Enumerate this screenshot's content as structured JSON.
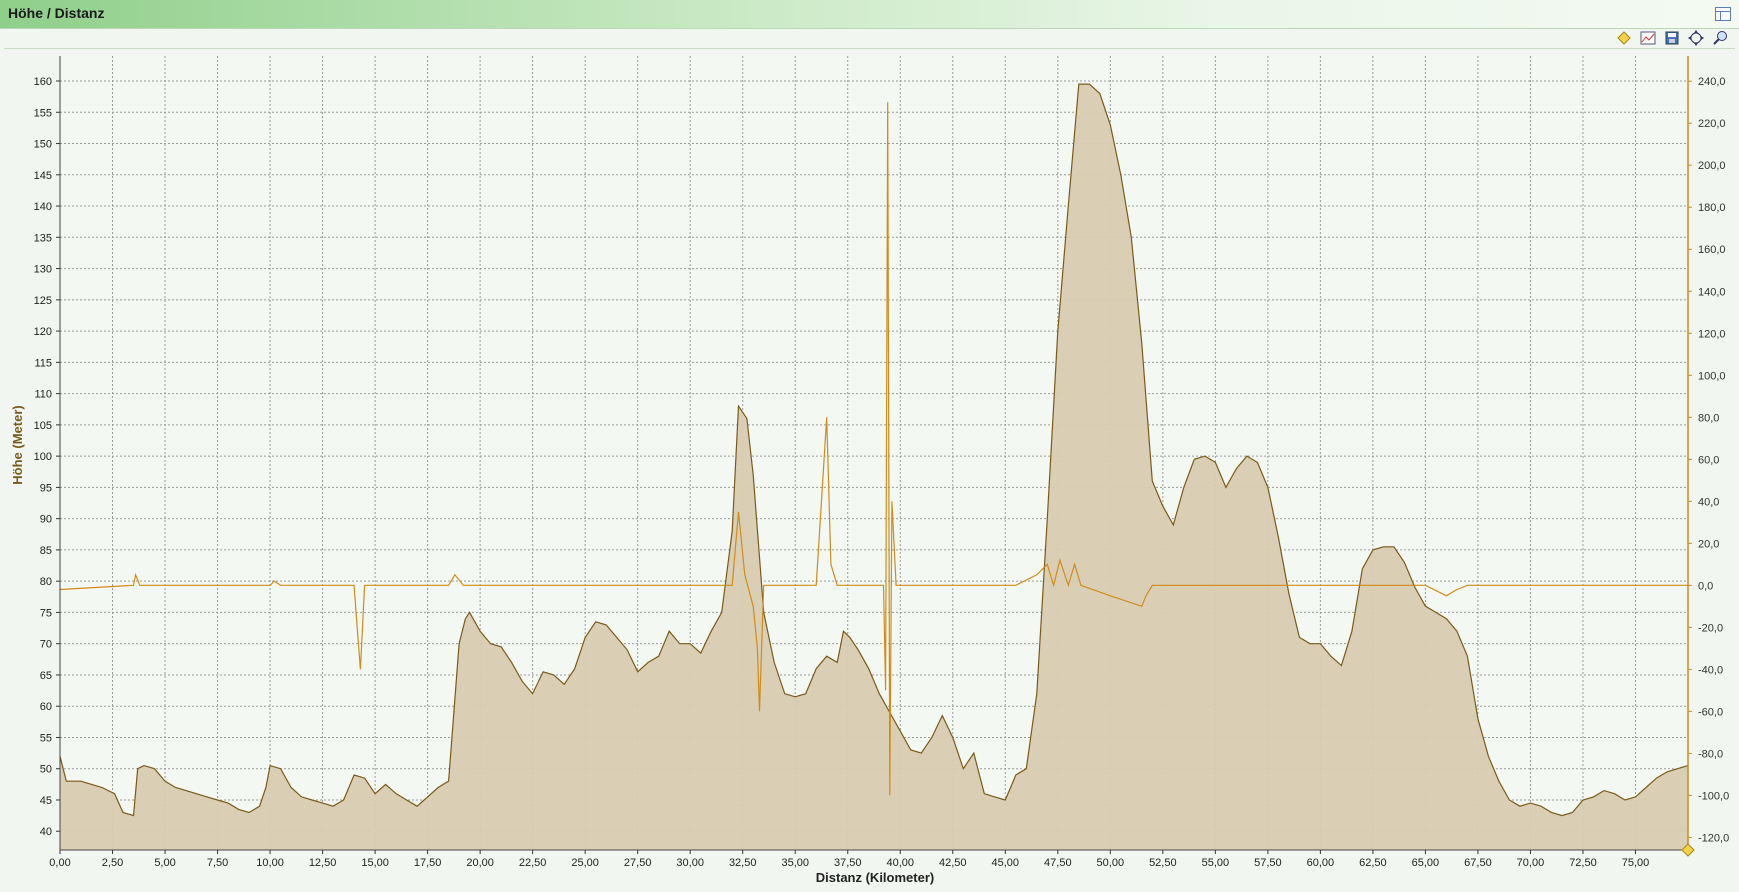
{
  "window": {
    "title": "Höhe / Distanz"
  },
  "toolbar": {
    "icons": [
      "diamond-marker-icon",
      "chart-view-icon",
      "save-icon",
      "center-icon",
      "zoom-icon"
    ]
  },
  "colors": {
    "area_fill": "#d8ccb0",
    "area_line": "#7a5a1a",
    "secondary_line": "#d08c1a",
    "grid": "#9a9a9a"
  },
  "chart_data": {
    "type": "area",
    "xlabel": "Distanz (Kilometer)",
    "ylabel": "Höhe (Meter)",
    "xlim": [
      0,
      77.5
    ],
    "ylim": [
      37,
      164
    ],
    "x_ticks": [
      "0,00",
      "2,50",
      "5,00",
      "7,50",
      "10,00",
      "12,50",
      "15,00",
      "17,50",
      "20,00",
      "22,50",
      "25,00",
      "27,50",
      "30,00",
      "32,50",
      "35,00",
      "37,50",
      "40,00",
      "42,50",
      "45,00",
      "47,50",
      "50,00",
      "52,50",
      "55,00",
      "57,50",
      "60,00",
      "62,50",
      "65,00",
      "67,50",
      "70,00",
      "72,50",
      "75,00"
    ],
    "y_ticks": [
      "40",
      "45",
      "50",
      "55",
      "60",
      "65",
      "70",
      "75",
      "80",
      "85",
      "90",
      "95",
      "100",
      "105",
      "110",
      "115",
      "120",
      "125",
      "130",
      "135",
      "140",
      "145",
      "150",
      "155",
      "160"
    ],
    "y2_ticks": [
      "-120,0",
      "-100,0",
      "-80,0",
      "-60,0",
      "-40,0",
      "-20,0",
      "0,0",
      "20,0",
      "40,0",
      "60,0",
      "80,0",
      "100,0",
      "120,0",
      "140,0",
      "160,0",
      "180,0",
      "200,0",
      "220,0",
      "240,0"
    ],
    "y2lim": [
      -126,
      252
    ],
    "series": [
      {
        "type": "area",
        "points": [
          [
            0,
            52
          ],
          [
            0.3,
            48
          ],
          [
            1,
            48
          ],
          [
            2,
            47
          ],
          [
            2.6,
            46
          ],
          [
            3,
            43
          ],
          [
            3.5,
            42.5
          ],
          [
            3.7,
            50
          ],
          [
            4,
            50.5
          ],
          [
            4.5,
            50
          ],
          [
            5,
            48
          ],
          [
            5.5,
            47
          ],
          [
            6,
            46.5
          ],
          [
            7,
            45.5
          ],
          [
            7.5,
            45
          ],
          [
            8,
            44.5
          ],
          [
            8.5,
            43.5
          ],
          [
            9,
            43
          ],
          [
            9.5,
            44
          ],
          [
            9.8,
            47
          ],
          [
            10,
            50.5
          ],
          [
            10.5,
            50
          ],
          [
            11,
            47
          ],
          [
            11.5,
            45.5
          ],
          [
            12,
            45
          ],
          [
            12.5,
            44.5
          ],
          [
            13,
            44
          ],
          [
            13.5,
            45
          ],
          [
            14,
            49
          ],
          [
            14.5,
            48.5
          ],
          [
            15,
            46
          ],
          [
            15.5,
            47.5
          ],
          [
            16,
            46
          ],
          [
            16.5,
            45
          ],
          [
            17,
            44
          ],
          [
            17.5,
            45.5
          ],
          [
            18,
            47
          ],
          [
            18.5,
            48
          ],
          [
            19,
            70
          ],
          [
            19.3,
            74
          ],
          [
            19.5,
            75
          ],
          [
            20,
            72
          ],
          [
            20.5,
            70
          ],
          [
            21,
            69.5
          ],
          [
            21.5,
            67
          ],
          [
            22,
            64
          ],
          [
            22.5,
            62
          ],
          [
            23,
            65.5
          ],
          [
            23.5,
            65
          ],
          [
            24,
            63.5
          ],
          [
            24.5,
            66
          ],
          [
            25,
            71
          ],
          [
            25.5,
            73.5
          ],
          [
            26,
            73
          ],
          [
            26.5,
            71
          ],
          [
            27,
            69
          ],
          [
            27.5,
            65.5
          ],
          [
            28,
            67
          ],
          [
            28.5,
            68
          ],
          [
            29,
            72
          ],
          [
            29.5,
            70
          ],
          [
            30,
            70
          ],
          [
            30.5,
            68.5
          ],
          [
            31,
            72
          ],
          [
            31.5,
            75
          ],
          [
            32,
            88
          ],
          [
            32.3,
            108
          ],
          [
            32.7,
            106
          ],
          [
            33,
            97
          ],
          [
            33.5,
            75
          ],
          [
            34,
            67
          ],
          [
            34.5,
            62
          ],
          [
            35,
            61.5
          ],
          [
            35.5,
            62
          ],
          [
            36,
            66
          ],
          [
            36.5,
            68
          ],
          [
            37,
            67
          ],
          [
            37.3,
            72
          ],
          [
            37.6,
            71
          ],
          [
            38,
            69
          ],
          [
            38.5,
            66
          ],
          [
            39,
            62
          ],
          [
            39.5,
            59
          ],
          [
            40,
            56
          ],
          [
            40.5,
            53
          ],
          [
            41,
            52.5
          ],
          [
            41.5,
            55
          ],
          [
            42,
            58.5
          ],
          [
            42.5,
            55
          ],
          [
            43,
            50
          ],
          [
            43.5,
            52.5
          ],
          [
            44,
            46
          ],
          [
            44.5,
            45.5
          ],
          [
            45,
            45
          ],
          [
            45.5,
            49
          ],
          [
            46,
            50
          ],
          [
            46.5,
            62
          ],
          [
            47,
            90
          ],
          [
            47.5,
            120
          ],
          [
            48,
            140
          ],
          [
            48.5,
            159.5
          ],
          [
            49,
            159.5
          ],
          [
            49.5,
            158
          ],
          [
            50,
            153
          ],
          [
            50.5,
            145
          ],
          [
            51,
            135
          ],
          [
            51.5,
            118
          ],
          [
            52,
            96
          ],
          [
            52.5,
            92
          ],
          [
            53,
            89
          ],
          [
            53.5,
            95
          ],
          [
            54,
            99.5
          ],
          [
            54.5,
            100
          ],
          [
            55,
            99
          ],
          [
            55.5,
            95
          ],
          [
            56,
            98
          ],
          [
            56.5,
            100
          ],
          [
            57,
            99
          ],
          [
            57.5,
            95
          ],
          [
            58,
            87
          ],
          [
            58.5,
            78
          ],
          [
            59,
            71
          ],
          [
            59.5,
            70
          ],
          [
            60,
            70
          ],
          [
            60.5,
            68
          ],
          [
            61,
            66.5
          ],
          [
            61.5,
            72
          ],
          [
            62,
            82
          ],
          [
            62.5,
            85
          ],
          [
            63,
            85.5
          ],
          [
            63.5,
            85.5
          ],
          [
            64,
            83
          ],
          [
            64.5,
            79
          ],
          [
            65,
            76
          ],
          [
            65.5,
            75
          ],
          [
            66,
            74
          ],
          [
            66.5,
            72
          ],
          [
            67,
            68
          ],
          [
            67.5,
            58
          ],
          [
            68,
            52
          ],
          [
            68.5,
            48
          ],
          [
            69,
            45
          ],
          [
            69.5,
            44
          ],
          [
            70,
            44.5
          ],
          [
            70.5,
            44
          ],
          [
            71,
            43
          ],
          [
            71.5,
            42.5
          ],
          [
            72,
            43
          ],
          [
            72.5,
            45
          ],
          [
            73,
            45.5
          ],
          [
            73.5,
            46.5
          ],
          [
            74,
            46
          ],
          [
            74.5,
            45
          ],
          [
            75,
            45.5
          ],
          [
            75.5,
            47
          ],
          [
            76,
            48.5
          ],
          [
            76.5,
            49.5
          ],
          [
            77,
            50
          ],
          [
            77.5,
            50.5
          ],
          [
            78,
            50
          ]
        ]
      },
      {
        "type": "line",
        "axis": "y2",
        "points": [
          [
            0,
            -2
          ],
          [
            3.5,
            0
          ],
          [
            3.6,
            5
          ],
          [
            3.8,
            0
          ],
          [
            10,
            0
          ],
          [
            10.2,
            2
          ],
          [
            10.5,
            0
          ],
          [
            14,
            0
          ],
          [
            14.1,
            -14
          ],
          [
            14.3,
            -40
          ],
          [
            14.5,
            0
          ],
          [
            18.5,
            0
          ],
          [
            18.8,
            5
          ],
          [
            19.2,
            0
          ],
          [
            32,
            0
          ],
          [
            32.3,
            35
          ],
          [
            32.6,
            5
          ],
          [
            33,
            -10
          ],
          [
            33.2,
            -30
          ],
          [
            33.3,
            -60
          ],
          [
            33.5,
            0
          ],
          [
            36,
            0
          ],
          [
            36.5,
            80
          ],
          [
            36.7,
            10
          ],
          [
            37,
            0
          ],
          [
            39.2,
            0
          ],
          [
            39.3,
            -50
          ],
          [
            39.4,
            230
          ],
          [
            39.5,
            -100
          ],
          [
            39.6,
            40
          ],
          [
            39.8,
            0
          ],
          [
            45.5,
            0
          ],
          [
            46.5,
            5
          ],
          [
            47,
            10
          ],
          [
            47.3,
            0
          ],
          [
            47.6,
            12
          ],
          [
            48,
            0
          ],
          [
            48.3,
            10
          ],
          [
            48.6,
            0
          ],
          [
            50,
            -5
          ],
          [
            51.5,
            -10
          ],
          [
            51.7,
            -5
          ],
          [
            52,
            0
          ],
          [
            65,
            0
          ],
          [
            66,
            -5
          ],
          [
            66.5,
            -2
          ],
          [
            67,
            0
          ],
          [
            77.5,
            0
          ]
        ]
      }
    ]
  }
}
